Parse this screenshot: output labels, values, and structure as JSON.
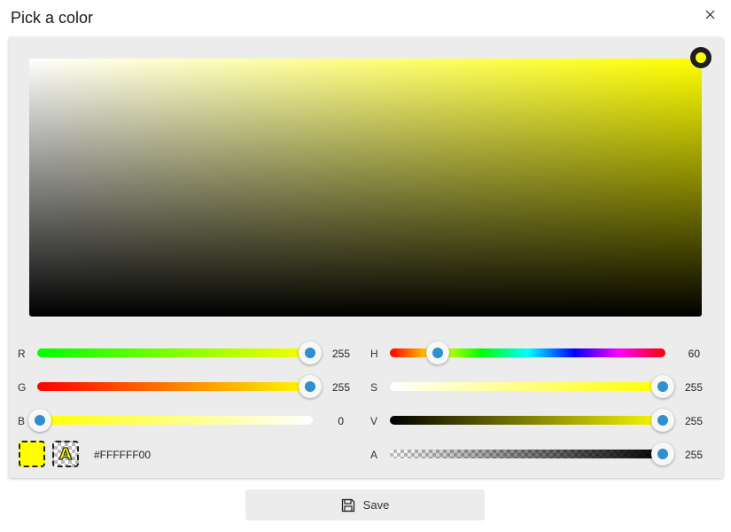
{
  "window": {
    "title": "Pick a color"
  },
  "picker": {
    "current_color": "#FFFF00",
    "saturation": 1.0,
    "brightness": 1.0
  },
  "sliders": {
    "r": {
      "label": "R",
      "value": "255",
      "fraction": 1.0
    },
    "g": {
      "label": "G",
      "value": "255",
      "fraction": 1.0
    },
    "b": {
      "label": "B",
      "value": "0",
      "fraction": 0.0
    },
    "h": {
      "label": "H",
      "value": "60",
      "fraction": 0.1667
    },
    "s": {
      "label": "S",
      "value": "255",
      "fraction": 1.0
    },
    "v": {
      "label": "V",
      "value": "255",
      "fraction": 1.0
    },
    "a": {
      "label": "A",
      "value": "255",
      "fraction": 1.0
    }
  },
  "swatches": {
    "hex": "#FFFFFF00",
    "alpha_letter": "A"
  },
  "footer": {
    "save_label": "Save"
  },
  "colors": {
    "accent": "#2F8FD0",
    "selected": "#FFFF00"
  },
  "icons": {
    "close": "close-icon",
    "save": "floppy-disk-icon"
  }
}
